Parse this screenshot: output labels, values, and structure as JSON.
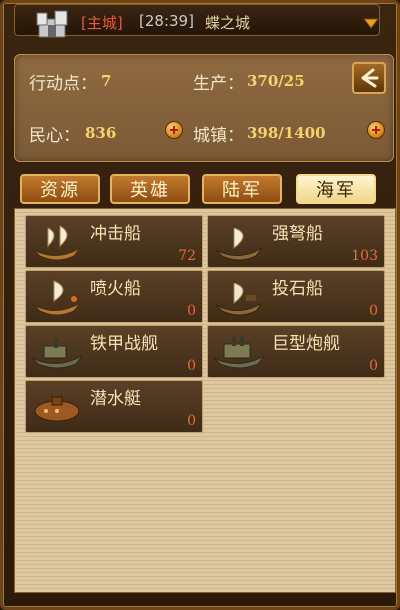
{
  "header": {
    "tag": "[主城]",
    "time": "[28:39]",
    "city": "蝶之城",
    "icons": {
      "castle": "castle-icon",
      "dropdown": "dropdown-arrow-icon"
    }
  },
  "stats": {
    "action_label": "行动点：",
    "action_value": "7",
    "production_label": "生产：",
    "production_value": "370/25",
    "morale_label": "民心：",
    "morale_value": "836",
    "towns_label": "城镇：",
    "towns_value": "398/1400"
  },
  "tabs": [
    "资源",
    "英雄",
    "陆军",
    "海军"
  ],
  "active_tab": "海军",
  "units": [
    {
      "name": "冲击船",
      "count": "72",
      "icon": "ship-icon"
    },
    {
      "name": "强弩船",
      "count": "103",
      "icon": "ship-icon"
    },
    {
      "name": "喷火船",
      "count": "0",
      "icon": "ship-icon"
    },
    {
      "name": "投石船",
      "count": "0",
      "icon": "ship-icon"
    },
    {
      "name": "铁甲战舰",
      "count": "0",
      "icon": "warship-icon"
    },
    {
      "name": "巨型炮舰",
      "count": "0",
      "icon": "warship-icon"
    },
    {
      "name": "潜水艇",
      "count": "0",
      "icon": "submarine-icon"
    }
  ],
  "colors": {
    "accent": "#f4d46b",
    "count": "#ea6a3a",
    "tag": "#e35a3e"
  }
}
